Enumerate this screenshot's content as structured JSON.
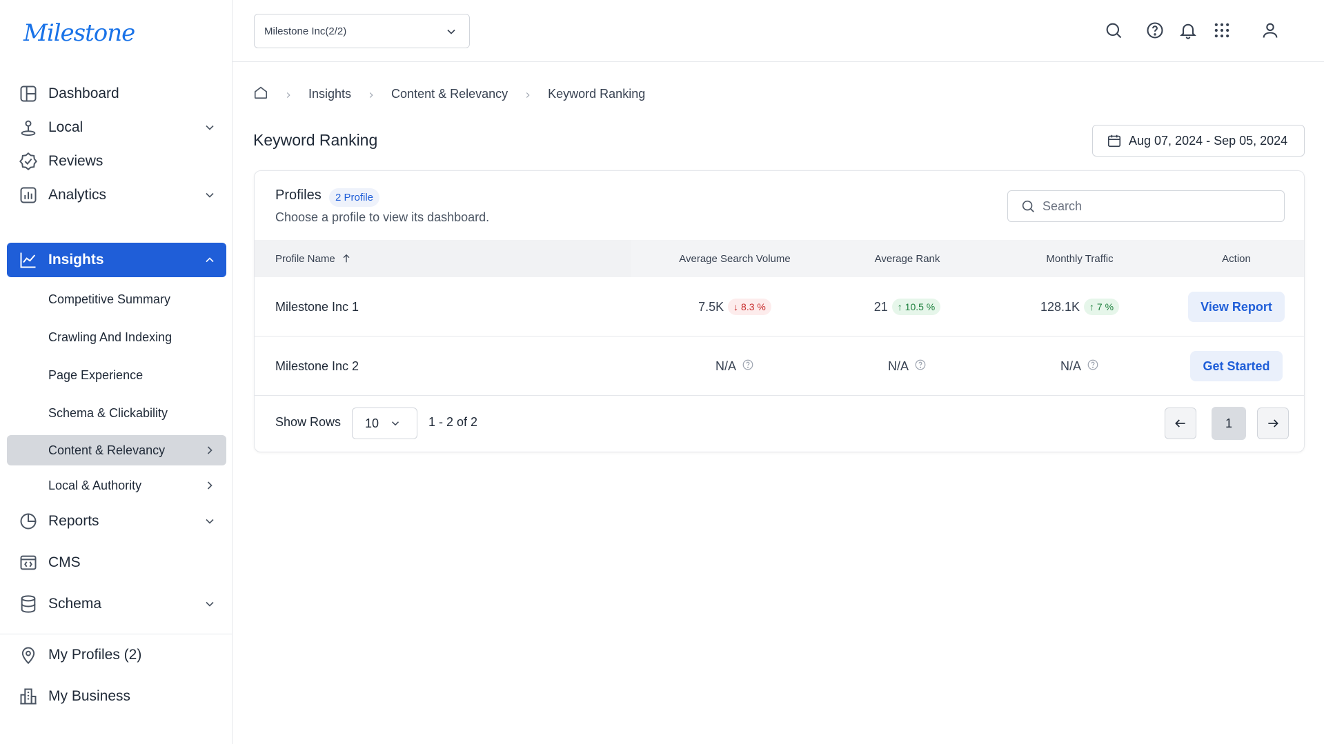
{
  "app": {
    "logo_text": "Milestone",
    "brand_color": "#1f5ed8"
  },
  "sidebar": {
    "items": [
      {
        "label": "Dashboard",
        "icon": "dashboard-icon"
      },
      {
        "label": "Local",
        "icon": "map-pin-icon"
      },
      {
        "label": "Reviews",
        "icon": "badge-check-icon"
      },
      {
        "label": "Analytics",
        "icon": "bar-chart-icon"
      },
      {
        "label": "Insights",
        "icon": "line-chart-icon"
      },
      {
        "label": "Reports",
        "icon": "pie-chart-icon"
      },
      {
        "label": "CMS",
        "icon": "code-window-icon"
      },
      {
        "label": "Schema",
        "icon": "database-icon"
      }
    ],
    "insights_sub": [
      "Competitive Summary",
      "Crawling And Indexing",
      "Page Experience",
      "Schema & Clickability",
      "Content & Relevancy",
      "Local & Authority"
    ],
    "bottom": [
      {
        "label": "My Profiles (2)",
        "icon": "location-icon"
      },
      {
        "label": "My Business",
        "icon": "building-icon"
      }
    ]
  },
  "topbar": {
    "org_select_value": "Milestone Inc(2/2)",
    "icons": [
      "search-icon",
      "help-icon",
      "bell-icon",
      "apps-grid-icon",
      "user-icon"
    ]
  },
  "breadcrumb": {
    "items": [
      "Insights",
      "Content & Relevancy",
      "Keyword Ranking"
    ]
  },
  "page": {
    "title": "Keyword Ranking",
    "date_range": "Aug 07, 2024 - Sep 05, 2024"
  },
  "profiles": {
    "title": "Profiles",
    "badge": "2 Profile",
    "subtitle": "Choose a profile to view its dashboard.",
    "search_placeholder": "Search",
    "columns": [
      "Profile Name",
      "Average Search Volume",
      "Average Rank",
      "Monthly Traffic",
      "Action"
    ],
    "rows": [
      {
        "name": "Milestone Inc 1",
        "search_volume": "7.5K",
        "search_volume_delta": "8.3 %",
        "search_volume_dir": "down",
        "rank": "21",
        "rank_delta": "10.5 %",
        "rank_dir": "up",
        "traffic": "128.1K",
        "traffic_delta": "7 %",
        "traffic_dir": "up",
        "action": "View Report"
      },
      {
        "name": "Milestone Inc 2",
        "search_volume": "N/A",
        "rank": "N/A",
        "traffic": "N/A",
        "action": "Get Started"
      }
    ],
    "footer": {
      "show_rows_label": "Show Rows",
      "rows_value": "10",
      "range": "1 - 2 of 2",
      "current_page": "1"
    }
  }
}
